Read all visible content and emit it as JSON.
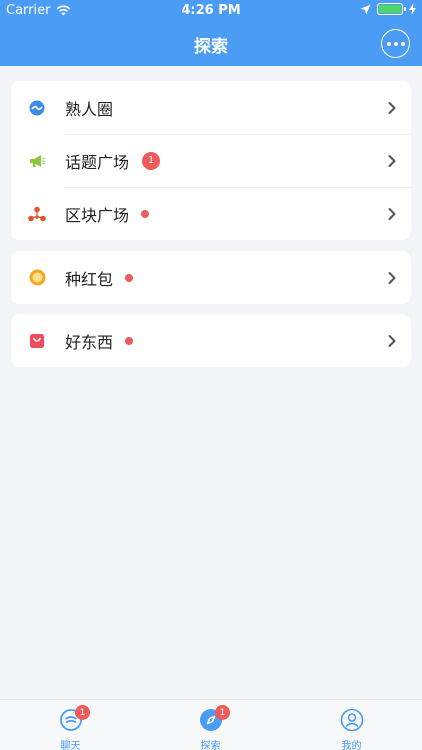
{
  "status_bar": {
    "carrier": "Carrier",
    "time": "4:26 PM"
  },
  "header": {
    "title": "探索",
    "more_icon": "more-dots-icon"
  },
  "cards": [
    {
      "rows": [
        {
          "label": "熟人圈",
          "icon": "circle-icon",
          "badge": null,
          "dot": false
        },
        {
          "label": "话题广场",
          "icon": "megaphone-icon",
          "badge": "1",
          "dot": false
        },
        {
          "label": "区块广场",
          "icon": "network-icon",
          "badge": null,
          "dot": true
        }
      ]
    },
    {
      "rows": [
        {
          "label": "种红包",
          "icon": "coin-icon",
          "badge": null,
          "dot": true
        }
      ]
    },
    {
      "rows": [
        {
          "label": "好东西",
          "icon": "shopping-bag-icon",
          "badge": null,
          "dot": true
        }
      ]
    }
  ],
  "tabbar": {
    "tabs": [
      {
        "label": "聊天",
        "icon": "chat-icon",
        "badge": "1"
      },
      {
        "label": "探索",
        "icon": "compass-icon",
        "badge": "1"
      },
      {
        "label": "我的",
        "icon": "profile-icon",
        "badge": null
      }
    ]
  },
  "colors": {
    "accent": "#4b9cf5",
    "badge": "#ef5a5a",
    "background": "#f3f5f9"
  }
}
